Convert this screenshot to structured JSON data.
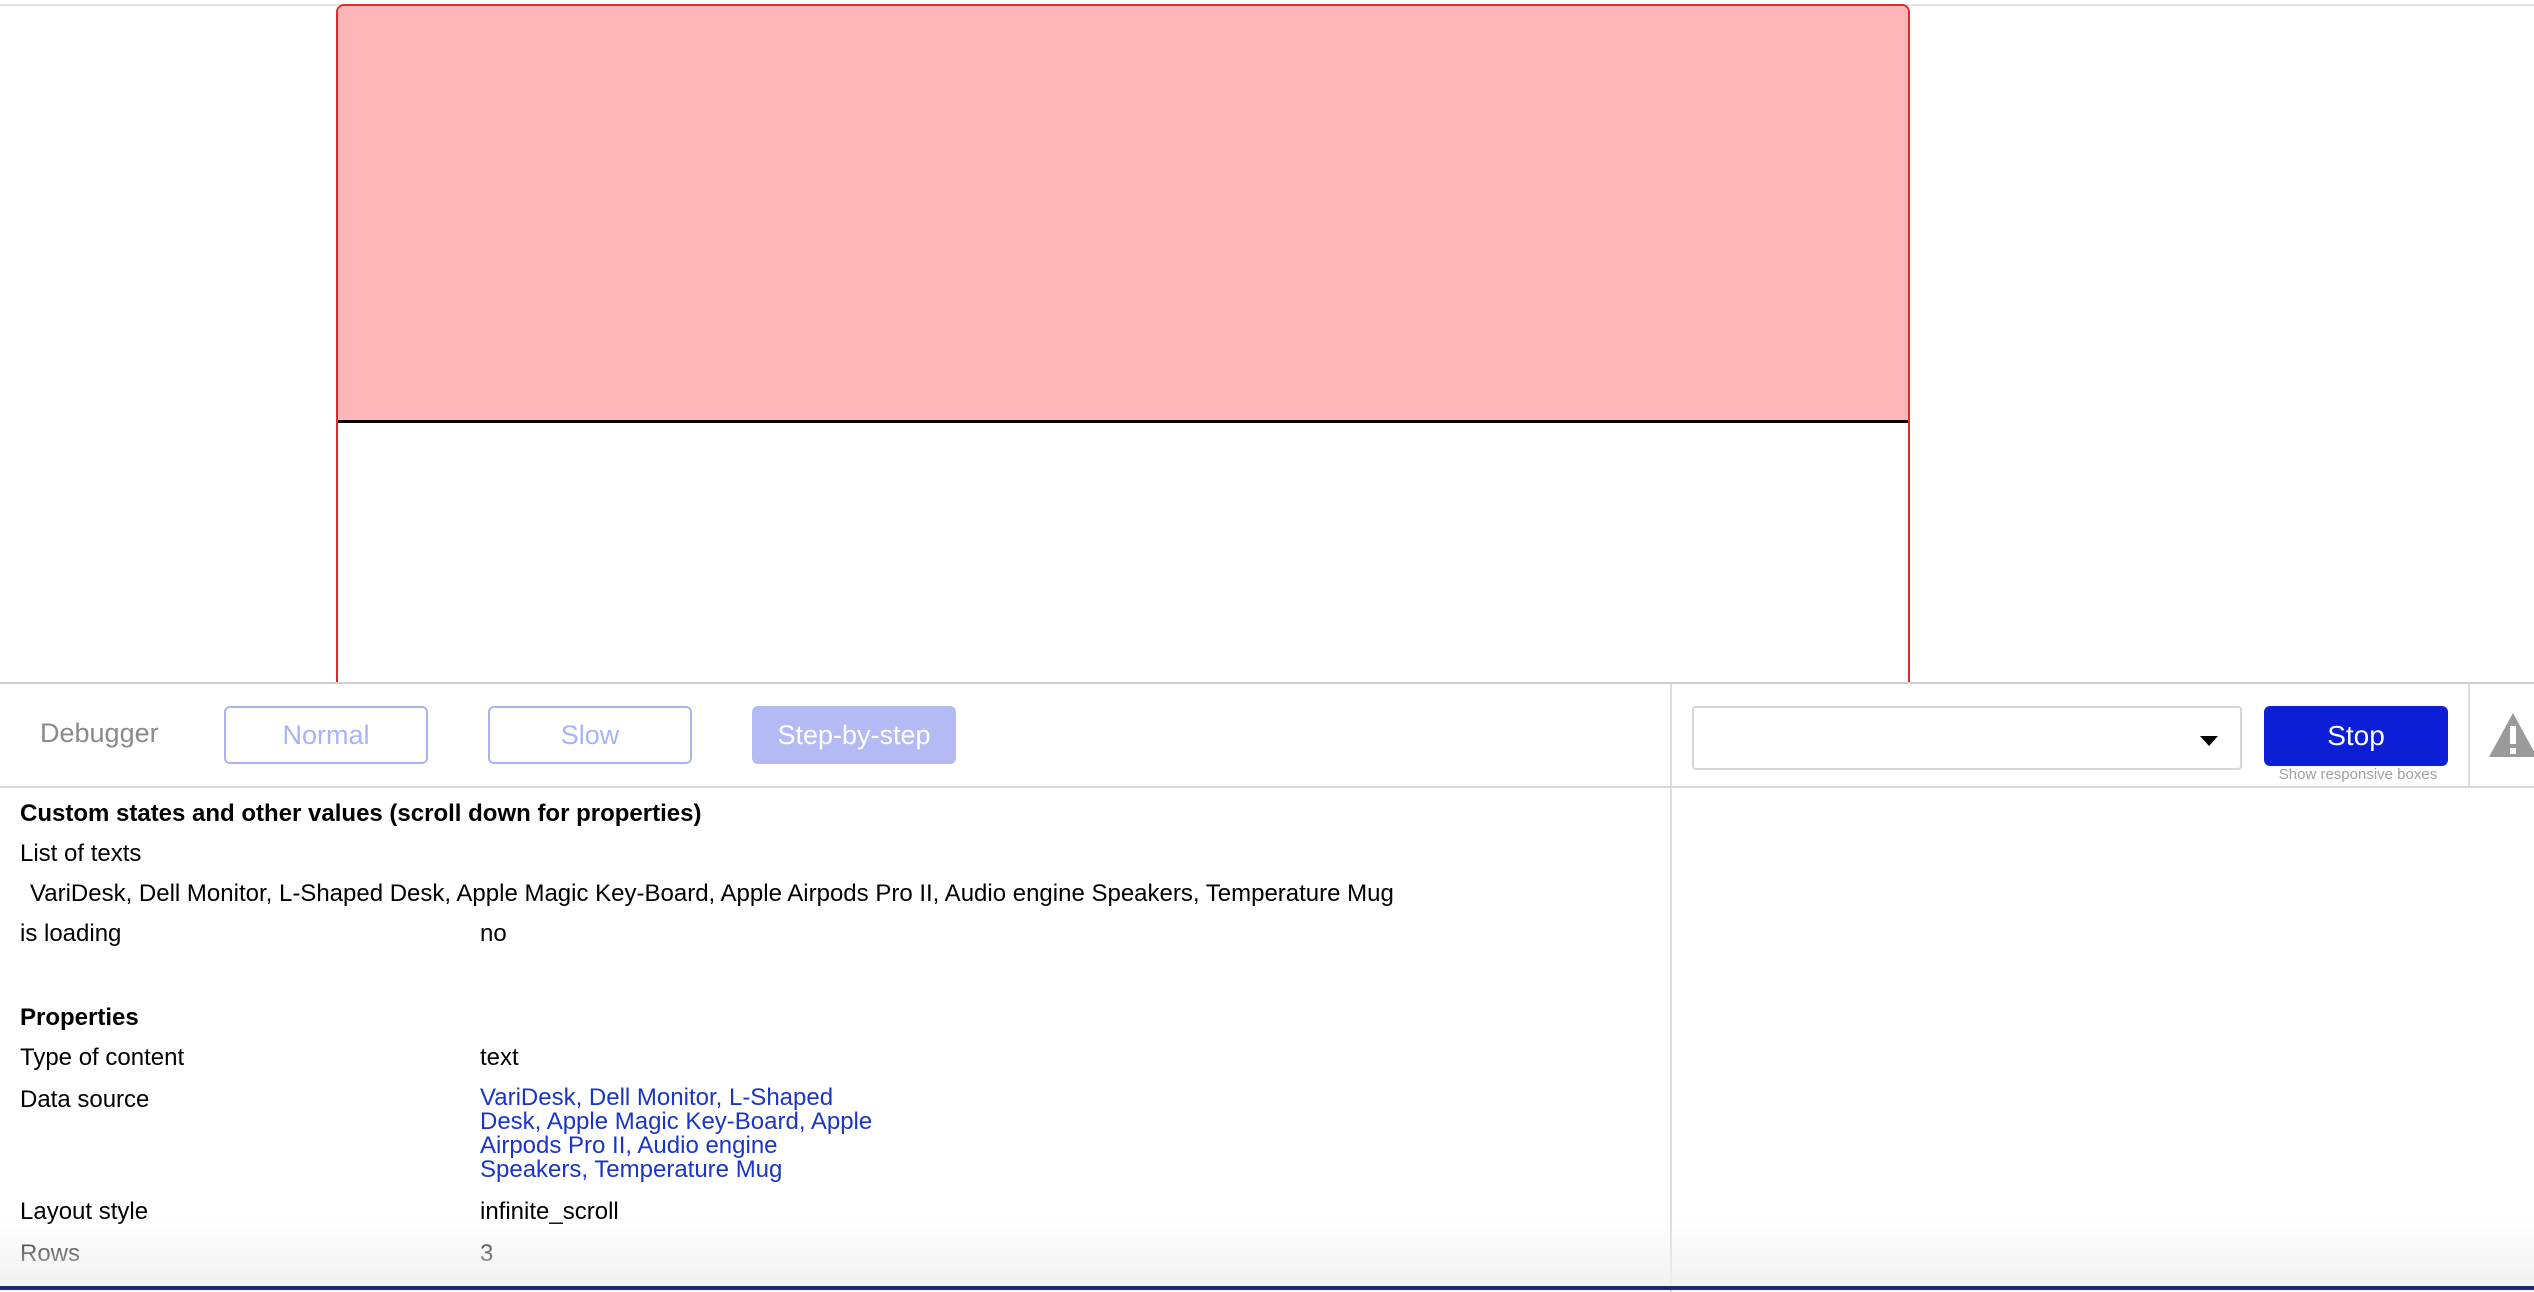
{
  "toolbar": {
    "title": "Debugger",
    "normal_label": "Normal",
    "slow_label": "Slow",
    "step_label": "Step-by-step",
    "element_select_value": "",
    "stop_label": "Stop",
    "responsive_label": "Show responsive boxes"
  },
  "states": {
    "section_title": "Custom states and other values (scroll down for properties)",
    "list_of_texts_label": "List of texts",
    "list_of_texts_value": "VariDesk, Dell Monitor, L-Shaped Desk, Apple Magic Key-Board, Apple Airpods Pro II, Audio engine Speakers, Temperature Mug",
    "is_loading_label": "is loading",
    "is_loading_value": "no"
  },
  "properties": {
    "section_title": "Properties",
    "type_label": "Type of content",
    "type_value": "text",
    "data_source_label": "Data source",
    "data_source_value": "VariDesk, Dell Monitor, L-Shaped Desk, Apple Magic Key-Board, Apple Airpods Pro II, Audio engine Speakers, Temperature Mug",
    "layout_label": "Layout style",
    "layout_value": "infinite_scroll",
    "rows_label": "Rows",
    "rows_value": "3"
  },
  "colors": {
    "accent": "#0d1fd6",
    "preview_fill": "#ffb6b9",
    "preview_border": "#e02a2a",
    "link": "#1a35c8"
  },
  "icons": {
    "element_select": "chevron-down-icon",
    "warning": "warning-icon"
  }
}
